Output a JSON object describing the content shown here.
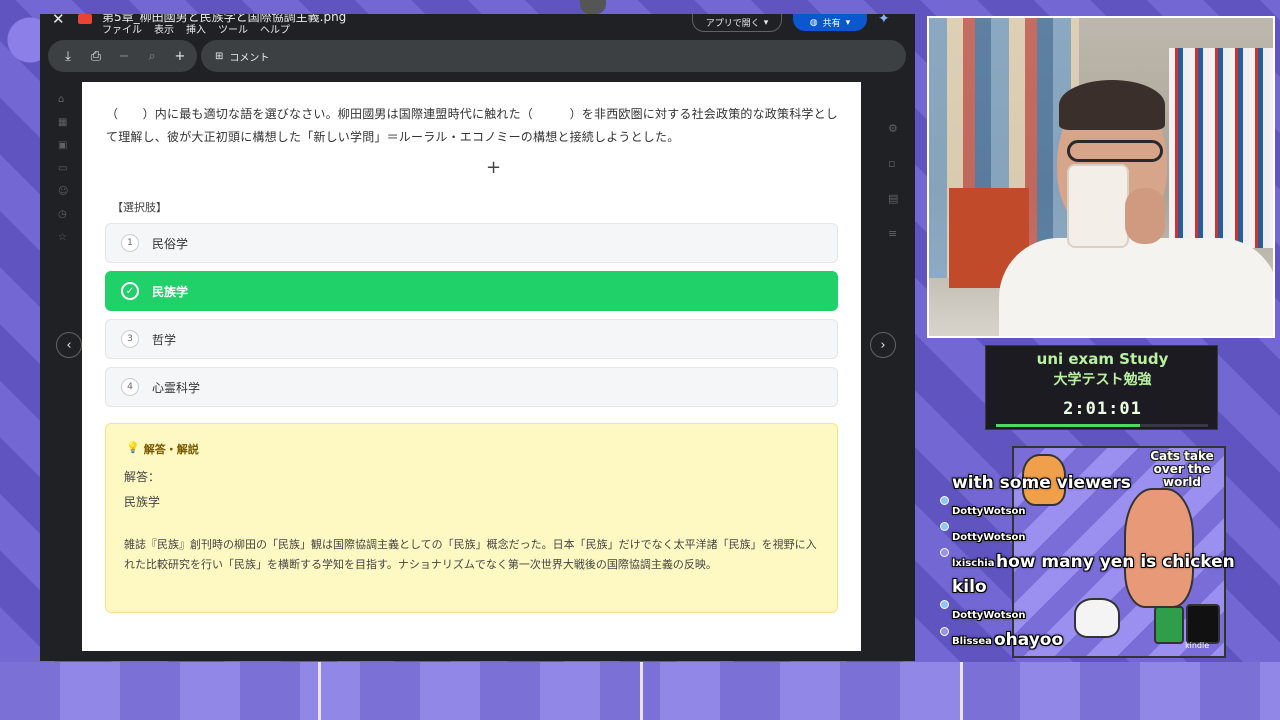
{
  "viewer": {
    "file_name": "第5章_柳田國男と民族学と国際協調主義.png",
    "menu": [
      "ファイル",
      "表示",
      "挿入",
      "ツール",
      "ヘルプ"
    ],
    "open_with_label": "アプリで開く",
    "share_label": "共有",
    "comment_label": "コメント"
  },
  "document": {
    "question": "（　　）内に最も適切な語を選びなさい。柳田國男は国際連盟時代に触れた（　　　）を非西欧圏に対する社会政策的な政策科学として理解し、彼が大正初頭に構想した「新しい学問」＝ルーラル・エコノミーの構想と接続しようとした。",
    "options_header": "【選択肢】",
    "options": [
      {
        "num": "1",
        "text": "民俗学",
        "correct": false
      },
      {
        "num": "✓",
        "text": "民族学",
        "correct": true
      },
      {
        "num": "3",
        "text": "哲学",
        "correct": false
      },
      {
        "num": "4",
        "text": "心霊科学",
        "correct": false
      }
    ],
    "answer_title": "解答・解説",
    "answer_label": "解答：",
    "answer_value": "民族学",
    "explanation": "雑誌『民族』創刊時の柳田の「民族」観は国際協調主義としての「民族」概念だった。日本「民族」だけでなく太平洋諸「民族」を視野に入れた比較研究を行い「民族」を横断する学知を目指す。ナショナリズムでなく第一次世界大戦後の国際協調主義の反映。"
  },
  "timer": {
    "title": "uni exam Study",
    "subtitle": "大学テスト勉強",
    "time": "2:01:01",
    "progress": 0.68
  },
  "overlay": {
    "cats_title": "Cats take over the world",
    "kindle": "kindle"
  },
  "chat": [
    {
      "user": "",
      "message": "with some viewers"
    },
    {
      "user": "DottyWotson",
      "message": ""
    },
    {
      "user": "DottyWotson",
      "message": ""
    },
    {
      "user": "lxischia",
      "message": "how many yen is chicken"
    },
    {
      "user": "",
      "message": "kilo"
    },
    {
      "user": "DottyWotson",
      "message": ""
    },
    {
      "user": "Blissea",
      "message": "ohayoo"
    }
  ],
  "colors": {
    "correct_green": "#1fd168",
    "answer_bg": "#fef9c3",
    "timer_text": "#b8f2a0",
    "share_blue": "#0b57d0"
  }
}
